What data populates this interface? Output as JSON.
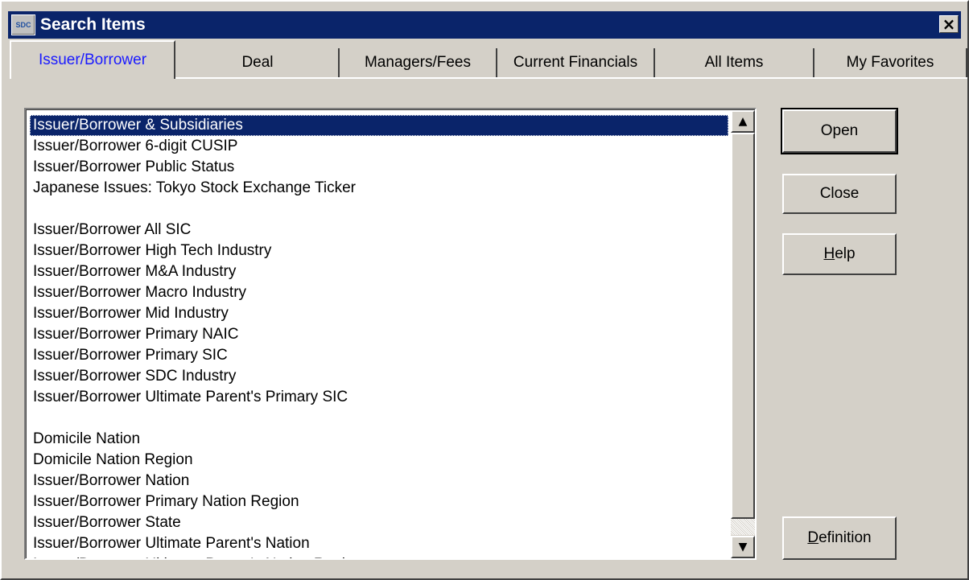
{
  "window": {
    "title": "Search Items",
    "app_icon_text": "SDC"
  },
  "tabs": [
    {
      "label": "Issuer/Borrower",
      "active": true
    },
    {
      "label": "Deal",
      "active": false
    },
    {
      "label": "Managers/Fees",
      "active": false
    },
    {
      "label": "Current Financials",
      "active": false
    },
    {
      "label": "All Items",
      "active": false
    },
    {
      "label": "My Favorites",
      "active": false
    }
  ],
  "list": {
    "items": [
      "Issuer/Borrower & Subsidiaries",
      "Issuer/Borrower 6-digit CUSIP",
      "Issuer/Borrower Public Status",
      "Japanese Issues: Tokyo Stock Exchange Ticker",
      "",
      "Issuer/Borrower All SIC",
      "Issuer/Borrower High Tech Industry",
      "Issuer/Borrower M&A Industry",
      "Issuer/Borrower Macro Industry",
      "Issuer/Borrower Mid Industry",
      "Issuer/Borrower Primary NAIC",
      "Issuer/Borrower Primary SIC",
      "Issuer/Borrower SDC Industry",
      "Issuer/Borrower Ultimate Parent's Primary SIC",
      "",
      "Domicile Nation",
      "Domicile Nation Region",
      "Issuer/Borrower Nation",
      "Issuer/Borrower Primary Nation Region",
      "Issuer/Borrower State",
      "Issuer/Borrower Ultimate Parent's Nation",
      "Issuer/Borrower Ultimate Parent's Nation Region"
    ],
    "selected_index": 0
  },
  "buttons": {
    "open": "Open",
    "close": "Close",
    "help_prefix": "H",
    "help_rest": "elp",
    "definition_prefix": "D",
    "definition_rest": "efinition"
  },
  "icons": {
    "close": "close-icon",
    "scroll_up": "scroll-up-arrow-icon",
    "scroll_down": "scroll-down-arrow-icon"
  },
  "colors": {
    "titlebar": "#0a246a",
    "selection": "#0a246a",
    "active_tab_text": "#1a1aff",
    "face": "#d4d0c8"
  }
}
